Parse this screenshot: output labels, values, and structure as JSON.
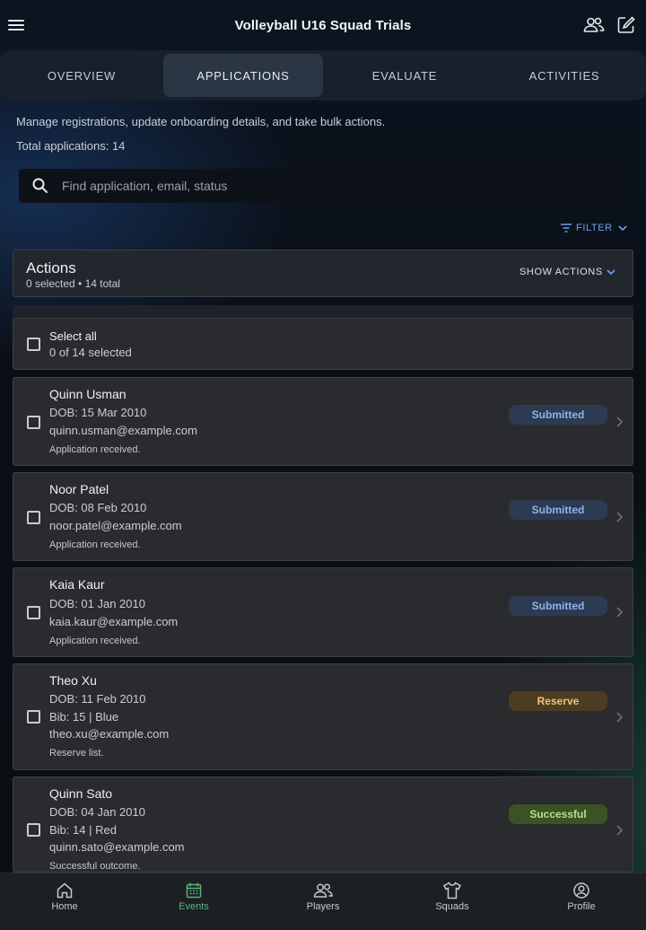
{
  "header": {
    "title": "Volleyball U16 Squad Trials"
  },
  "tabs": [
    {
      "label": "OVERVIEW",
      "active": false
    },
    {
      "label": "APPLICATIONS",
      "active": true
    },
    {
      "label": "EVALUATE",
      "active": false
    },
    {
      "label": "ACTIVITIES",
      "active": false
    }
  ],
  "intro": {
    "description": "Manage registrations, update onboarding details, and take bulk actions.",
    "total": "Total applications: 14"
  },
  "search": {
    "placeholder": "Find application, email, status"
  },
  "filter_label": "FILTER",
  "actions": {
    "title": "Actions",
    "summary": "0 selected • 14 total",
    "show_label": "SHOW ACTIONS"
  },
  "select_all": {
    "label": "Select all",
    "count": "0 of 14 selected"
  },
  "applications": [
    {
      "name": "Quinn Usman",
      "dob": "DOB: 15 Mar 2010",
      "bib": "",
      "email": "quinn.usman@example.com",
      "note": "Application received.",
      "status": "Submitted"
    },
    {
      "name": "Noor Patel",
      "dob": "DOB: 08 Feb 2010",
      "bib": "",
      "email": "noor.patel@example.com",
      "note": "Application received.",
      "status": "Submitted"
    },
    {
      "name": "Kaia Kaur",
      "dob": "DOB: 01 Jan 2010",
      "bib": "",
      "email": "kaia.kaur@example.com",
      "note": "Application received.",
      "status": "Submitted"
    },
    {
      "name": "Theo Xu",
      "dob": "DOB: 11 Feb 2010",
      "bib": "Bib: 15 | Blue",
      "email": "theo.xu@example.com",
      "note": "Reserve list.",
      "status": "Reserve"
    },
    {
      "name": "Quinn Sato",
      "dob": "DOB: 04 Jan 2010",
      "bib": "Bib: 14 | Red",
      "email": "quinn.sato@example.com",
      "note": "Successful outcome.",
      "status": "Successful"
    }
  ],
  "status_colors": {
    "Submitted": {
      "bg": "#2c3b52",
      "fg": "#8fb4ea"
    },
    "Reserve": {
      "bg": "#4c3c22",
      "fg": "#f0c27a"
    },
    "Successful": {
      "bg": "#3b5226",
      "fg": "#b8e08a"
    }
  },
  "bottom_nav": [
    {
      "label": "Home",
      "icon": "home-icon",
      "active": false
    },
    {
      "label": "Events",
      "icon": "calendar-icon",
      "active": true
    },
    {
      "label": "Players",
      "icon": "players-icon",
      "active": false
    },
    {
      "label": "Squads",
      "icon": "shirt-icon",
      "active": false
    },
    {
      "label": "Profile",
      "icon": "profile-icon",
      "active": false
    }
  ]
}
